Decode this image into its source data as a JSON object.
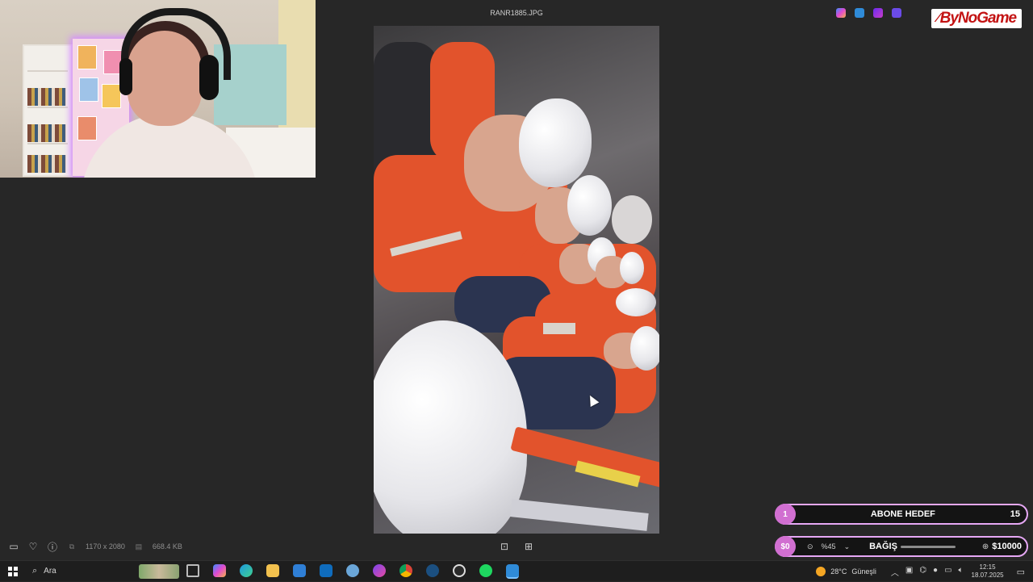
{
  "viewer": {
    "file_name": "RANR1885.JPG",
    "dimensions": "1170 x 2080",
    "file_size": "668.4 KB"
  },
  "brand": {
    "name": "ByNoGame"
  },
  "widgets": {
    "subscriber_goal": {
      "index": "1",
      "label": "ABONE HEDEF",
      "count": "15"
    },
    "donation": {
      "amount": "$0",
      "zoom": "%45",
      "label": "BAĞIŞ",
      "goal": "$10000",
      "progress": 0
    }
  },
  "taskbar": {
    "search_placeholder": "Ara",
    "weather": "28°C",
    "weather_desc": "Güneşli",
    "time": "12:15",
    "date": "18.07.2025"
  },
  "colors": {
    "accent": "#e6a8f5",
    "pill": "#d16fd1",
    "brand_red": "#c31313"
  }
}
